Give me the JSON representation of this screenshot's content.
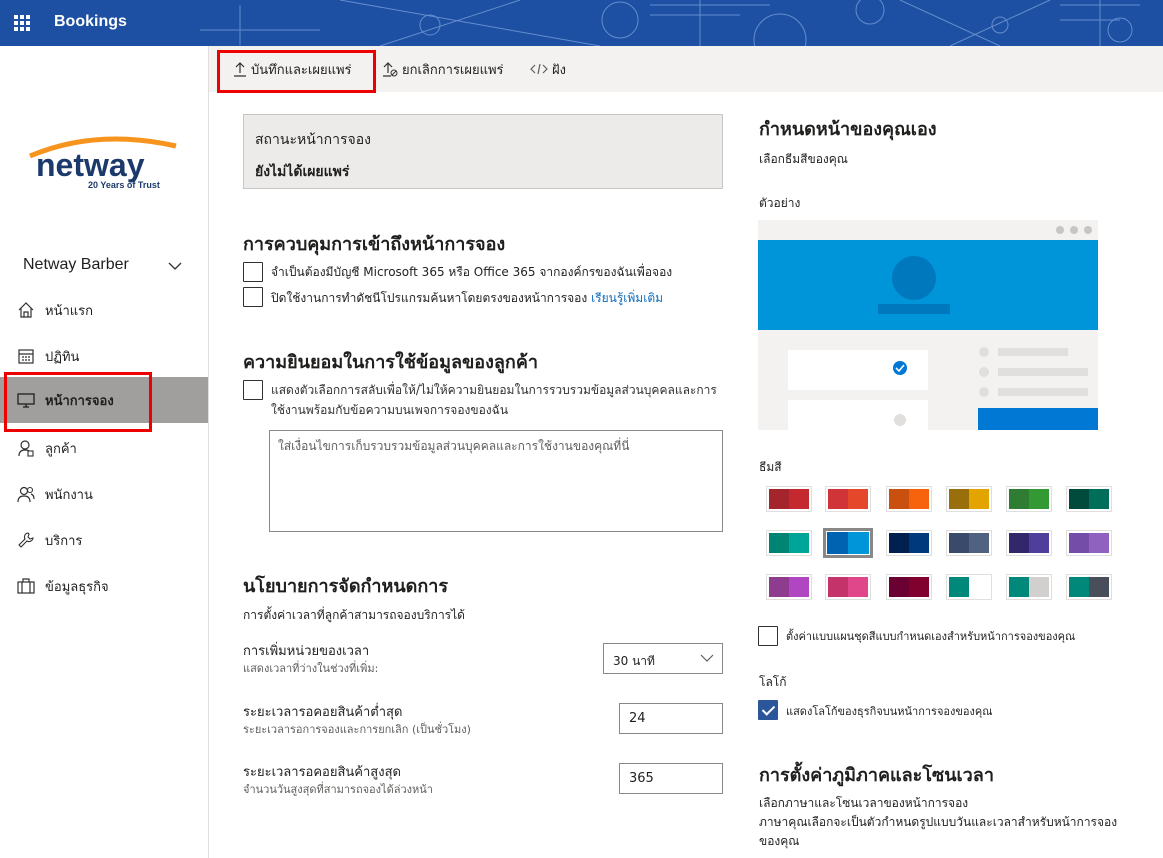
{
  "app": {
    "title": "Bookings"
  },
  "brand": {
    "accent": "#0078d4",
    "header_bg": "#1d4fa3",
    "logo_orange": "#f7941d",
    "logo_navy": "#1b3a6b"
  },
  "logo": {
    "word": "netway",
    "tagline": "20 Years of Trust"
  },
  "sidebar": {
    "business_name": "Netway Barber",
    "items": [
      {
        "label": "หน้าแรก",
        "icon": "home-icon"
      },
      {
        "label": "ปฏิทิน",
        "icon": "calendar-icon"
      },
      {
        "label": "หน้าการจอง",
        "icon": "monitor-icon",
        "active": true
      },
      {
        "label": "ลูกค้า",
        "icon": "person-icon"
      },
      {
        "label": "พนักงาน",
        "icon": "people-icon"
      },
      {
        "label": "บริการ",
        "icon": "wrench-icon"
      },
      {
        "label": "ข้อมูลธุรกิจ",
        "icon": "briefcase-icon"
      }
    ]
  },
  "commands": {
    "save_publish": "บันทึกและเผยแพร่",
    "unpublish": "ยกเลิกการเผยแพร่",
    "embed": "ฝัง"
  },
  "status": {
    "title": "สถานะหน้าการจอง",
    "value": "ยังไม่ได้เผยแพร่"
  },
  "access": {
    "heading": "การควบคุมการเข้าถึงหน้าการจอง",
    "option1": "จำเป็นต้องมีบัญชี Microsoft 365 หรือ Office 365 จากองค์กรของฉันเพื่อจอง",
    "option2": "ปิดใช้งานการทำดัชนีโปรแกรมค้นหาโดยตรงของหน้าการจอง",
    "learn_more": "เรียนรู้เพิ่มเติม"
  },
  "consent": {
    "heading": "ความยินยอมในการใช้ข้อมูลของลูกค้า",
    "option_line1": "แสดงตัวเลือกการสลับเพื่อให้/ไม่ให้ความยินยอมในการรวบรวมข้อมูลส่วนบุคคลและการ",
    "option_line2": "ใช้งานพร้อมกับข้อความบนเพจการจองของฉัน",
    "placeholder": "ใส่เงื่อนไขการเก็บรวบรวมข้อมูลส่วนบุคคลและการใช้งานของคุณที่นี่"
  },
  "policy": {
    "heading": "นโยบายการจัดกำหนดการ",
    "subtitle": "การตั้งค่าเวลาที่ลูกค้าสามารถจองบริการได้",
    "increment_label": "การเพิ่มหน่วยของเวลา",
    "increment_hint": "แสดงเวลาที่ว่างในช่วงที่เพิ่ม:",
    "increment_value": "30 นาที",
    "min_lead_label": "ระยะเวลารอคอยสินค้าต่ำสุด",
    "min_lead_hint": "ระยะเวลารอการจองและการยกเลิก (เป็นชั่วโมง)",
    "min_lead_value": "24",
    "max_lead_label": "ระยะเวลารอคอยสินค้าสูงสุด",
    "max_lead_hint": "จำนวนวันสูงสุดที่สามารถจองได้ล่วงหน้า",
    "max_lead_value": "365"
  },
  "customize": {
    "heading": "กำหนดหน้าของคุณเอง",
    "subtitle": "เลือกธีมสีของคุณ",
    "preview_label": "ตัวอย่าง",
    "theme_label": "ธีมสี",
    "custom_theme": "ตั้งค่าแบบแผนชุดสีแบบกำหนดเองสำหรับหน้าการจองของคุณ",
    "logo_label": "โลโก้",
    "show_logo": "แสดงโลโก้ของธุรกิจบนหน้าการจองของคุณ",
    "swatches": [
      [
        "#a4262c",
        "#c3292e"
      ],
      [
        "#d13438",
        "#e4472a"
      ],
      [
        "#ca5010",
        "#f7630c"
      ],
      [
        "#986f0b",
        "#e3a400"
      ],
      [
        "#2e7d32",
        "#339933"
      ],
      [
        "#004b3c",
        "#006e58"
      ],
      [
        "#008575",
        "#00a59a"
      ],
      [
        "#0063b1",
        "#0095d9"
      ],
      [
        "#002050",
        "#003a7c"
      ],
      [
        "#3a4a6b",
        "#50627f"
      ],
      [
        "#32276b",
        "#4f3e9c"
      ],
      [
        "#744da9",
        "#8e62be"
      ],
      [
        "#8e3c8e",
        "#b146c2"
      ],
      [
        "#c4336a",
        "#e0478a"
      ],
      [
        "#6b0033",
        "#80002e"
      ],
      [
        "#00897b",
        "#ffffff"
      ],
      [
        "#00897b",
        "#d2d0ce"
      ],
      [
        "#00897b",
        "#484f5b"
      ]
    ]
  },
  "region": {
    "heading": "การตั้งค่าภูมิภาคและโซนเวลา",
    "line1": "เลือกภาษาและโซนเวลาของหน้าการจอง",
    "line2": "ภาษาคุณเลือกจะเป็นตัวกำหนดรูปแบบวันและเวลาสำหรับหน้าการจอง",
    "line3": "ของคุณ"
  }
}
